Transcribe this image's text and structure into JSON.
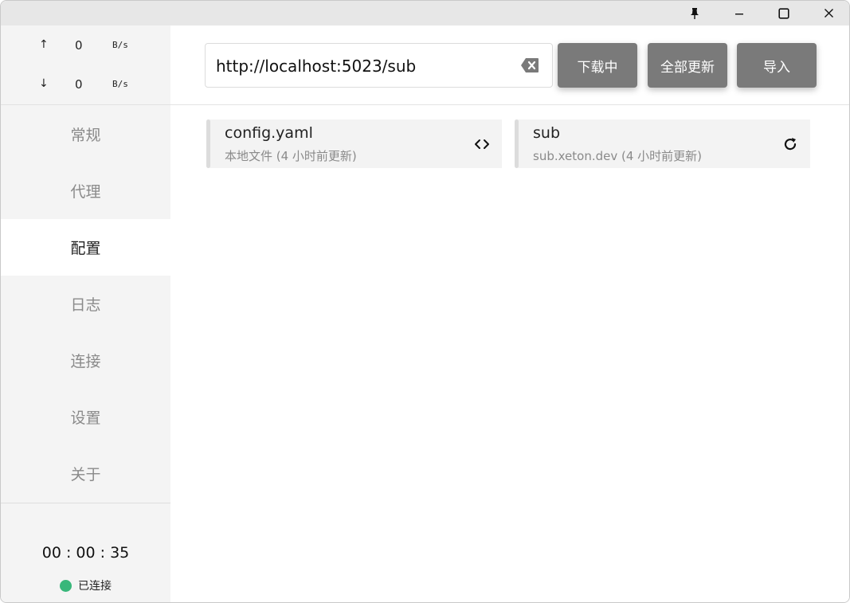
{
  "window": {
    "controls": [
      "pin-icon",
      "minimize-icon",
      "maximize-icon",
      "close-icon"
    ]
  },
  "traffic": {
    "up_arrow": "↑",
    "up_value": "0",
    "up_unit": "B/s",
    "down_arrow": "↓",
    "down_value": "0",
    "down_unit": "B/s"
  },
  "sidebar": {
    "items": [
      {
        "label": "常规"
      },
      {
        "label": "代理"
      },
      {
        "label": "配置"
      },
      {
        "label": "日志"
      },
      {
        "label": "连接"
      },
      {
        "label": "设置"
      },
      {
        "label": "关于"
      }
    ],
    "active_index": 2,
    "timer": "00 : 00 : 35",
    "status_text": "已连接",
    "status_color": "#38b77a"
  },
  "toolbar": {
    "url_value": "http://localhost:5023/sub",
    "download_label": "下载中",
    "update_all_label": "全部更新",
    "import_label": "导入",
    "button_color": "#7a7a7a"
  },
  "profiles": [
    {
      "title": "config.yaml",
      "subtitle": "本地文件 (4 小时前更新)",
      "icon": "code-icon"
    },
    {
      "title": "sub",
      "subtitle": "sub.xeton.dev (4 小时前更新)",
      "icon": "refresh-icon"
    }
  ]
}
